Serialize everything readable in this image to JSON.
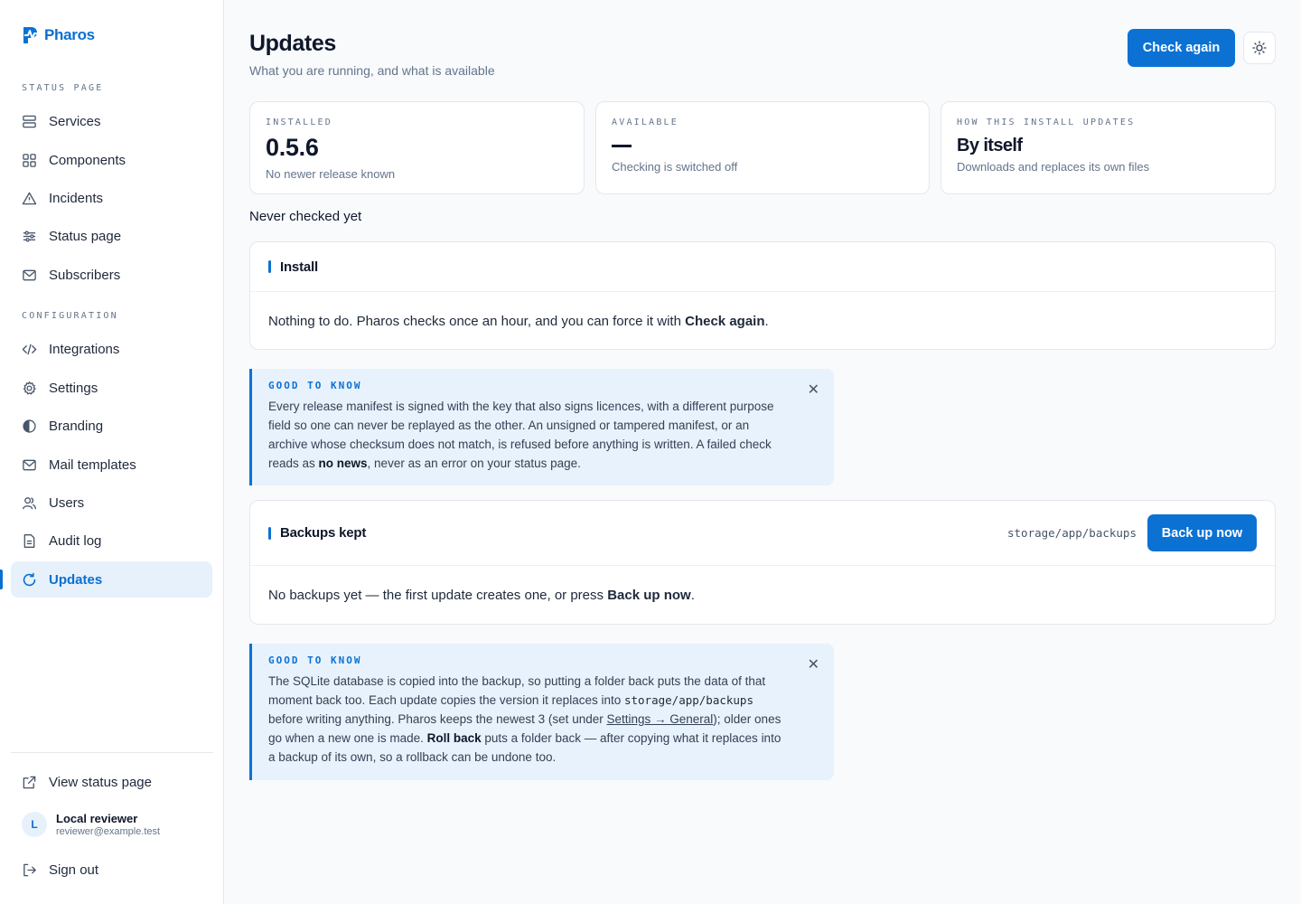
{
  "brand": {
    "name": "Pharos"
  },
  "sidebar": {
    "section_status": "STATUS PAGE",
    "section_config": "CONFIGURATION",
    "items": [
      {
        "label": "Services",
        "icon": "server-icon"
      },
      {
        "label": "Components",
        "icon": "grid-icon"
      },
      {
        "label": "Incidents",
        "icon": "warning-triangle-icon"
      },
      {
        "label": "Status page",
        "icon": "sliders-icon"
      },
      {
        "label": "Subscribers",
        "icon": "mail-icon"
      },
      {
        "label": "Integrations",
        "icon": "code-icon"
      },
      {
        "label": "Settings",
        "icon": "gear-icon"
      },
      {
        "label": "Branding",
        "icon": "contrast-icon"
      },
      {
        "label": "Mail templates",
        "icon": "mail-icon"
      },
      {
        "label": "Users",
        "icon": "users-icon"
      },
      {
        "label": "Audit log",
        "icon": "document-icon"
      },
      {
        "label": "Updates",
        "icon": "refresh-icon",
        "active": true
      }
    ],
    "view_status_page": "View status page",
    "sign_out": "Sign out",
    "user": {
      "initial": "L",
      "name": "Local reviewer",
      "email": "reviewer@example.test"
    }
  },
  "header": {
    "title": "Updates",
    "subtitle": "What you are running, and what is available",
    "check_again": "Check again"
  },
  "stats": {
    "installed": {
      "label": "INSTALLED",
      "value": "0.5.6",
      "note": "No newer release known"
    },
    "available": {
      "label": "AVAILABLE",
      "value": "—",
      "note": "Checking is switched off"
    },
    "mode": {
      "label": "HOW THIS INSTALL UPDATES",
      "value": "By itself",
      "note": "Downloads and replaces its own files"
    }
  },
  "never_checked": "Never checked yet",
  "install_panel": {
    "title": "Install",
    "body_prefix": "Nothing to do. Pharos checks once an hour, and you can force it with ",
    "body_bold": "Check again",
    "body_suffix": "."
  },
  "callout1": {
    "label": "GOOD TO KNOW",
    "text_a": "Every release manifest is signed with the key that also signs licences, with a different purpose field so one can never be replayed as the other. An unsigned or tampered manifest, or an archive whose checksum does not match, is refused before anything is written. A failed check reads as ",
    "text_bold": "no news",
    "text_b": ", never as an error on your status page."
  },
  "backups_panel": {
    "title": "Backups kept",
    "path": "storage/app/backups",
    "button": "Back up now",
    "body_prefix": "No backups yet — the first update creates one, or press ",
    "body_bold": "Back up now",
    "body_suffix": "."
  },
  "callout2": {
    "label": "GOOD TO KNOW",
    "text_a": "The SQLite database is copied into the backup, so putting a folder back puts the data of that moment back too. Each update copies the version it replaces into ",
    "code": "storage/app/backups",
    "text_b": " before writing anything. Pharos keeps the newest 3 (set under ",
    "link": "Settings → General",
    "text_c": "); older ones go when a new one is made. ",
    "text_bold": "Roll back",
    "text_d": " puts a folder back — after copying what it replaces into a backup of its own, so a rollback can be undone too."
  },
  "colors": {
    "accent": "#0b72d4",
    "callout_bg": "#e8f2fc"
  }
}
